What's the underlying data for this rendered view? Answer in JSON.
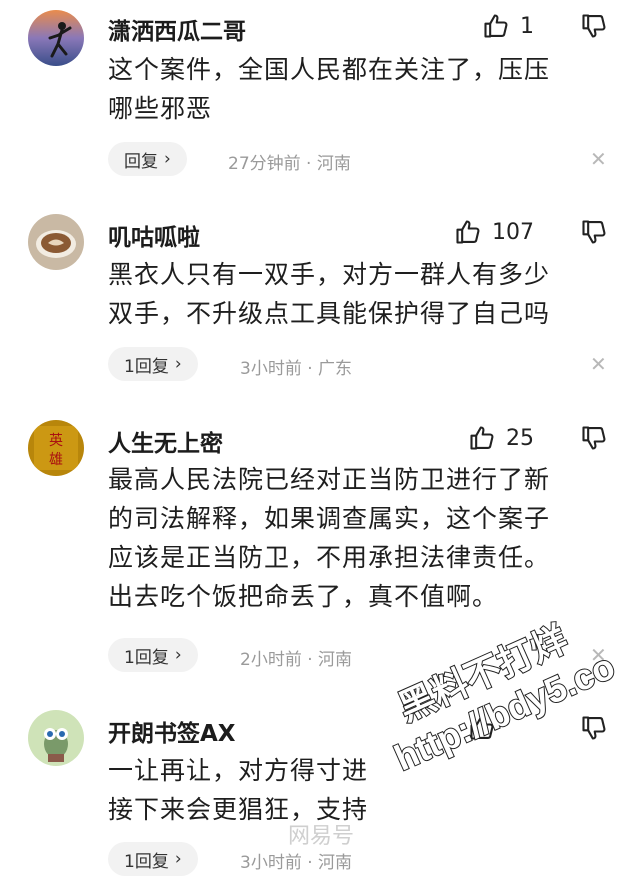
{
  "comments": [
    {
      "username": "潇洒西瓜二哥",
      "likes": "1",
      "text_lines": [
        "这个案件，全国人民都在关注了，压压",
        "哪些邪恶"
      ],
      "reply_label": "回复",
      "meta": "27分钟前 · 河南"
    },
    {
      "username": "叽咕呱啦",
      "likes": "107",
      "text_lines": [
        "黑衣人只有一双手，对方一群人有多少",
        "双手，不升级点工具能保护得了自己吗"
      ],
      "reply_label": "1回复",
      "meta": "3小时前 · 广东"
    },
    {
      "username": "人生无上密",
      "likes": "25",
      "text_lines": [
        "最高人民法院已经对正当防卫进行了新",
        "的司法解释，如果调查属实，这个案子",
        "应该是正当防卫，不用承担法律责任。",
        "出去吃个饭把命丢了，真不值啊。"
      ],
      "reply_label": "1回复",
      "meta": "2小时前 · 河南"
    },
    {
      "username": "开朗书签AX",
      "likes": "",
      "text_lines": [
        "一让再让，对方得寸进",
        "接下来会更猖狂，支持"
      ],
      "reply_label": "1回复",
      "meta": "3小时前 · 河南"
    }
  ],
  "icons": {
    "like": "thumbs-up-icon",
    "dislike": "thumbs-down-icon",
    "chevron": "chevron-right-icon",
    "close": "close-icon"
  },
  "watermark": {
    "line1": "黑料不打烊",
    "line2": "http://bdy5.co",
    "brand": "网易号"
  },
  "colors": {
    "text": "#1e1e1e",
    "meta": "#9a9a9a",
    "reply_bg": "#f2f2f2"
  }
}
